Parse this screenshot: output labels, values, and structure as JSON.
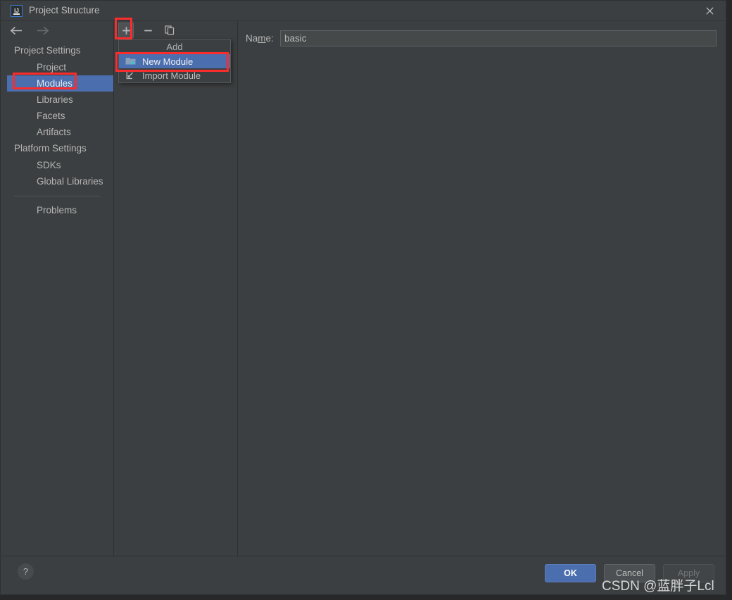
{
  "window": {
    "title": "Project Structure",
    "app_icon": "intellij-idea-icon",
    "close_icon": "close-icon"
  },
  "sidebar": {
    "back_icon": "arrow-left-icon",
    "forward_icon": "arrow-right-icon",
    "groups": [
      {
        "label": "Project Settings",
        "items": [
          {
            "label": "Project",
            "selected": false
          },
          {
            "label": "Modules",
            "selected": true
          },
          {
            "label": "Libraries",
            "selected": false
          },
          {
            "label": "Facets",
            "selected": false
          },
          {
            "label": "Artifacts",
            "selected": false
          }
        ]
      },
      {
        "label": "Platform Settings",
        "items": [
          {
            "label": "SDKs",
            "selected": false
          },
          {
            "label": "Global Libraries",
            "selected": false
          }
        ]
      }
    ],
    "problems": {
      "label": "Problems"
    }
  },
  "toolbar": {
    "add_icon": "plus-icon",
    "remove_icon": "minus-icon",
    "copy_icon": "copy-icon"
  },
  "popup_menu": {
    "title": "Add",
    "items": [
      {
        "label": "New Module",
        "icon": "module-folder-icon",
        "highlighted": true
      },
      {
        "label": "Import Module",
        "icon": "import-arrow-icon",
        "highlighted": false
      }
    ]
  },
  "content": {
    "name_label_pre": "Na",
    "name_label_mnemonic": "m",
    "name_label_post": "e:",
    "name_value": "basic",
    "name_placeholder": ""
  },
  "footer": {
    "help_icon": "question-mark-icon",
    "buttons": [
      {
        "label": "OK",
        "style": "primary"
      },
      {
        "label": "Cancel",
        "style": "normal"
      },
      {
        "label": "Apply",
        "style": "disabled"
      }
    ]
  },
  "annotations": {
    "watermark": "CSDN @蓝胖子Lcl",
    "highlight_color": "#fb2c2c"
  }
}
